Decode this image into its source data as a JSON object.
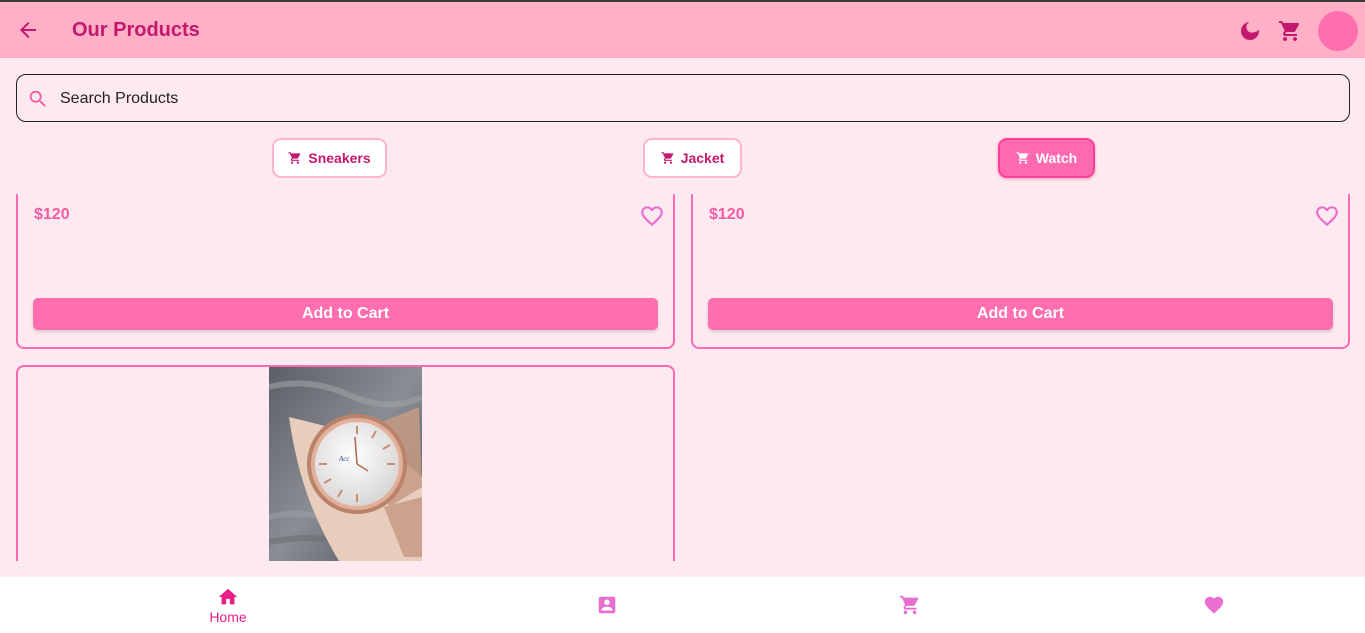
{
  "header": {
    "title": "Our Products",
    "icons": [
      "back-arrow-icon",
      "moon-icon",
      "cart-icon",
      "avatar"
    ]
  },
  "search": {
    "placeholder": "Search Products",
    "value": ""
  },
  "categories": [
    {
      "label": "Sneakers",
      "selected": false
    },
    {
      "label": "Jacket",
      "selected": false
    },
    {
      "label": "Watch",
      "selected": true
    }
  ],
  "products": [
    {
      "price": "$120",
      "button": "Add to Cart"
    },
    {
      "price": "$120",
      "button": "Add to Cart"
    },
    {
      "image": "wristwatch-photo"
    }
  ],
  "bottom_nav": {
    "items": [
      {
        "icon": "home-icon",
        "label": "Home",
        "active": true
      },
      {
        "icon": "contact-icon",
        "label": ""
      },
      {
        "icon": "cart-icon",
        "label": ""
      },
      {
        "icon": "heart-icon",
        "label": ""
      }
    ]
  },
  "colors": {
    "accent": "#ff6eaf",
    "header_bg": "#ffafc6",
    "page_bg": "#fdeaf0",
    "primary_text": "#c2186e"
  }
}
